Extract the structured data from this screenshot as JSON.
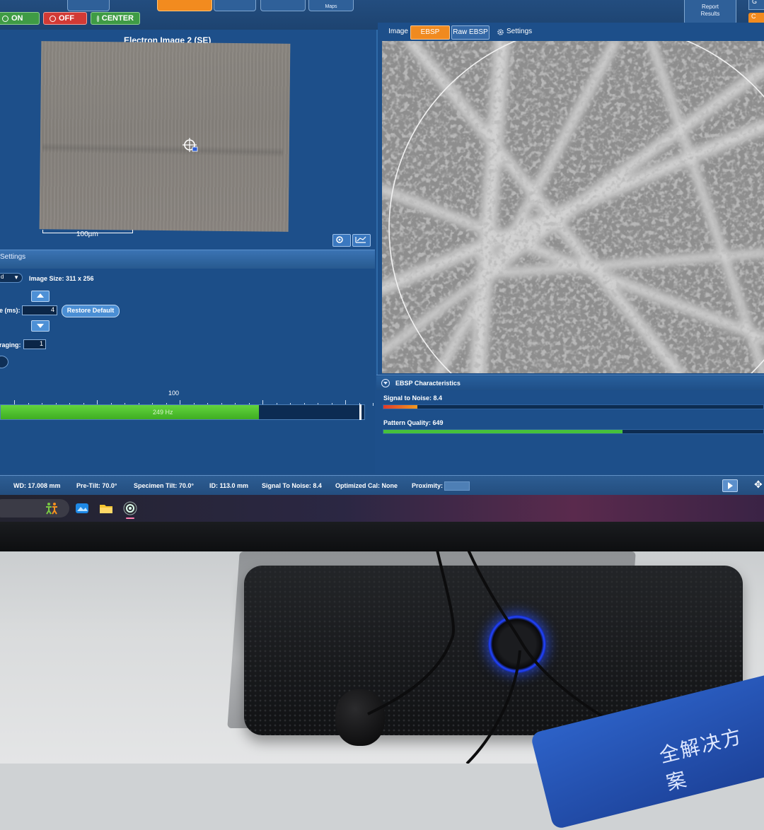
{
  "controls": {
    "on_label": "ON",
    "off_label": "OFF",
    "center_label": "CENTER"
  },
  "top_tabs": {
    "maps_label": "Maps",
    "report_line1": "Report",
    "report_line2": "Results",
    "edge_label": "G",
    "edge_orange_label": "C"
  },
  "electron_image": {
    "title": "Electron Image 2 (SE)",
    "scale_label": "100µm"
  },
  "settings": {
    "header": "Settings",
    "mode_value": "d",
    "image_size": "Image Size: 311 x 256",
    "dwell_label": "e (ms):",
    "dwell_value": "4",
    "restore_default": "Restore Default",
    "averaging_label": "raging:",
    "averaging_value": "1",
    "tick_100": "100",
    "rate_label": "249 Hz",
    "rate_fill_fraction": 0.71
  },
  "right_tabs": {
    "image": "Image",
    "ebsp": "EBSP",
    "raw_ebsp": "Raw EBSP",
    "settings": "Settings"
  },
  "characteristics": {
    "title": "EBSP Characteristics",
    "snr_label": "Signal to Noise: 8.4",
    "snr_fraction": 0.09,
    "pq_label": "Pattern Quality: 649",
    "pq_fraction": 0.63
  },
  "status": {
    "wd": "WD: 17.008 mm",
    "pretilt": "Pre-Tilt: 70.0°",
    "specimen_tilt": "Specimen Tilt: 70.0°",
    "id": "ID: 113.0 mm",
    "snr": "Signal To Noise: 8.4",
    "optimized_cal": "Optimized Cal: None",
    "proximity": "Proximity:"
  },
  "cloth_text": "全解决方案",
  "colors": {
    "panel_blue": "#1d4f8a",
    "accent_orange": "#f08a1f",
    "on_green": "#3f9b45",
    "off_red": "#d23a35",
    "rate_green": "#62d43d"
  }
}
